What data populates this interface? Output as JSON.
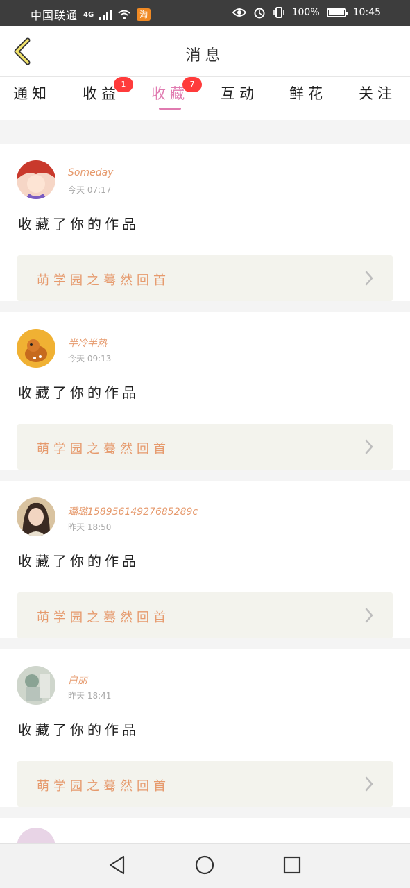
{
  "status_bar": {
    "carrier": "中国联通",
    "network": "4G",
    "battery_percent": "100%",
    "time": "10:45",
    "icons": [
      "signal-icon",
      "wifi-icon",
      "taobao-app-icon",
      "eye-icon",
      "alarm-icon",
      "vibrate-icon",
      "battery-icon"
    ]
  },
  "header": {
    "title": "消息",
    "back_icon": "chevron-left-icon"
  },
  "tabs": [
    {
      "label": "通知",
      "badge": ""
    },
    {
      "label": "收益",
      "badge": "1"
    },
    {
      "label": "收藏",
      "badge": "7",
      "active": true
    },
    {
      "label": "互动",
      "badge": ""
    },
    {
      "label": "鲜花",
      "badge": ""
    },
    {
      "label": "关注",
      "badge": ""
    }
  ],
  "notifications": [
    {
      "user": "Someday",
      "time": "今天 07:17",
      "action": "收藏了你的作品",
      "work": "萌学园之蓦然回首"
    },
    {
      "user": "半冷半热",
      "time": "今天 09:13",
      "action": "收藏了你的作品",
      "work": "萌学园之蓦然回首"
    },
    {
      "user": "璐璐15895614927685289c",
      "time": "昨天 18:50",
      "action": "收藏了你的作品",
      "work": "萌学园之蓦然回首"
    },
    {
      "user": "白丽",
      "time": "昨天 18:41",
      "action": "收藏了你的作品",
      "work": "萌学园之蓦然回首"
    }
  ],
  "colors": {
    "accent": "#e07ab0",
    "name": "#e69a6d",
    "badge": "#ff3b3b"
  }
}
